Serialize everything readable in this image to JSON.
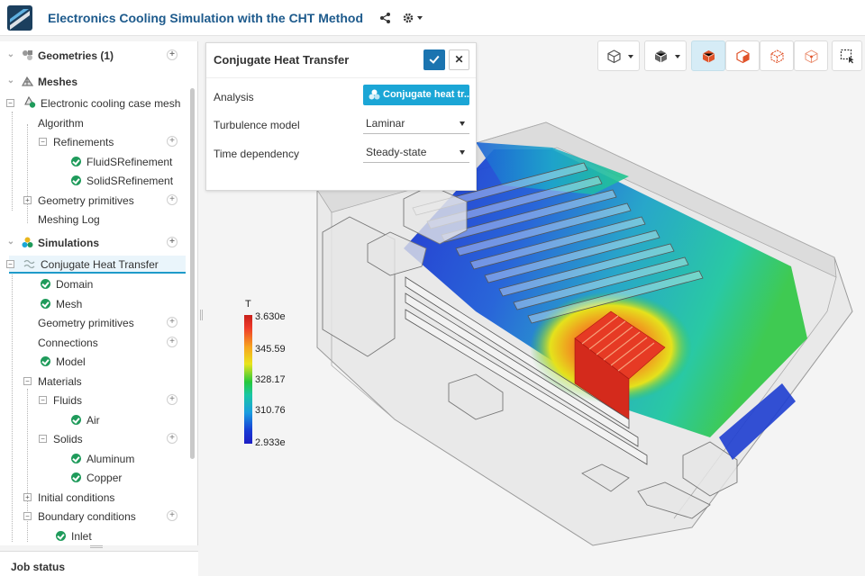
{
  "header": {
    "title": "Electronics Cooling Simulation with the CHT Method",
    "logo_icon": "simscale-logo-icon",
    "share_icon": "share-icon",
    "settings_icon": "gear-icon"
  },
  "tree": {
    "geometries": {
      "label": "Geometries (1)"
    },
    "meshes": {
      "label": "Meshes",
      "mesh_name": "Electronic cooling case mesh",
      "algorithm": "Algorithm",
      "refinements": "Refinements",
      "fluid_refinement": "FluidSRefinement",
      "solid_refinement": "SolidSRefinement",
      "geometry_primitives": "Geometry primitives",
      "meshing_log": "Meshing Log"
    },
    "simulations": {
      "label": "Simulations",
      "sim_name": "Conjugate Heat Transfer",
      "domain": "Domain",
      "mesh": "Mesh",
      "geometry_primitives": "Geometry primitives",
      "connections": "Connections",
      "model": "Model",
      "materials": "Materials",
      "fluids": "Fluids",
      "air": "Air",
      "solids": "Solids",
      "aluminum": "Aluminum",
      "copper": "Copper",
      "initial_conditions": "Initial conditions",
      "boundary_conditions": "Boundary conditions",
      "inlet": "Inlet"
    }
  },
  "job_status": "Job status",
  "dialog": {
    "title": "Conjugate Heat Transfer",
    "analysis_label": "Analysis",
    "analysis_button": "Conjugate heat tr...",
    "turbulence_label": "Turbulence model",
    "turbulence_value": "Laminar",
    "time_label": "Time dependency",
    "time_value": "Steady-state",
    "colors": {
      "confirm": "#1b74b0",
      "analysis_button": "#1ba6d6"
    }
  },
  "legend": {
    "title": "T",
    "values": [
      "3.630e",
      "345.59",
      "328.17",
      "310.76",
      "2.933e"
    ]
  }
}
